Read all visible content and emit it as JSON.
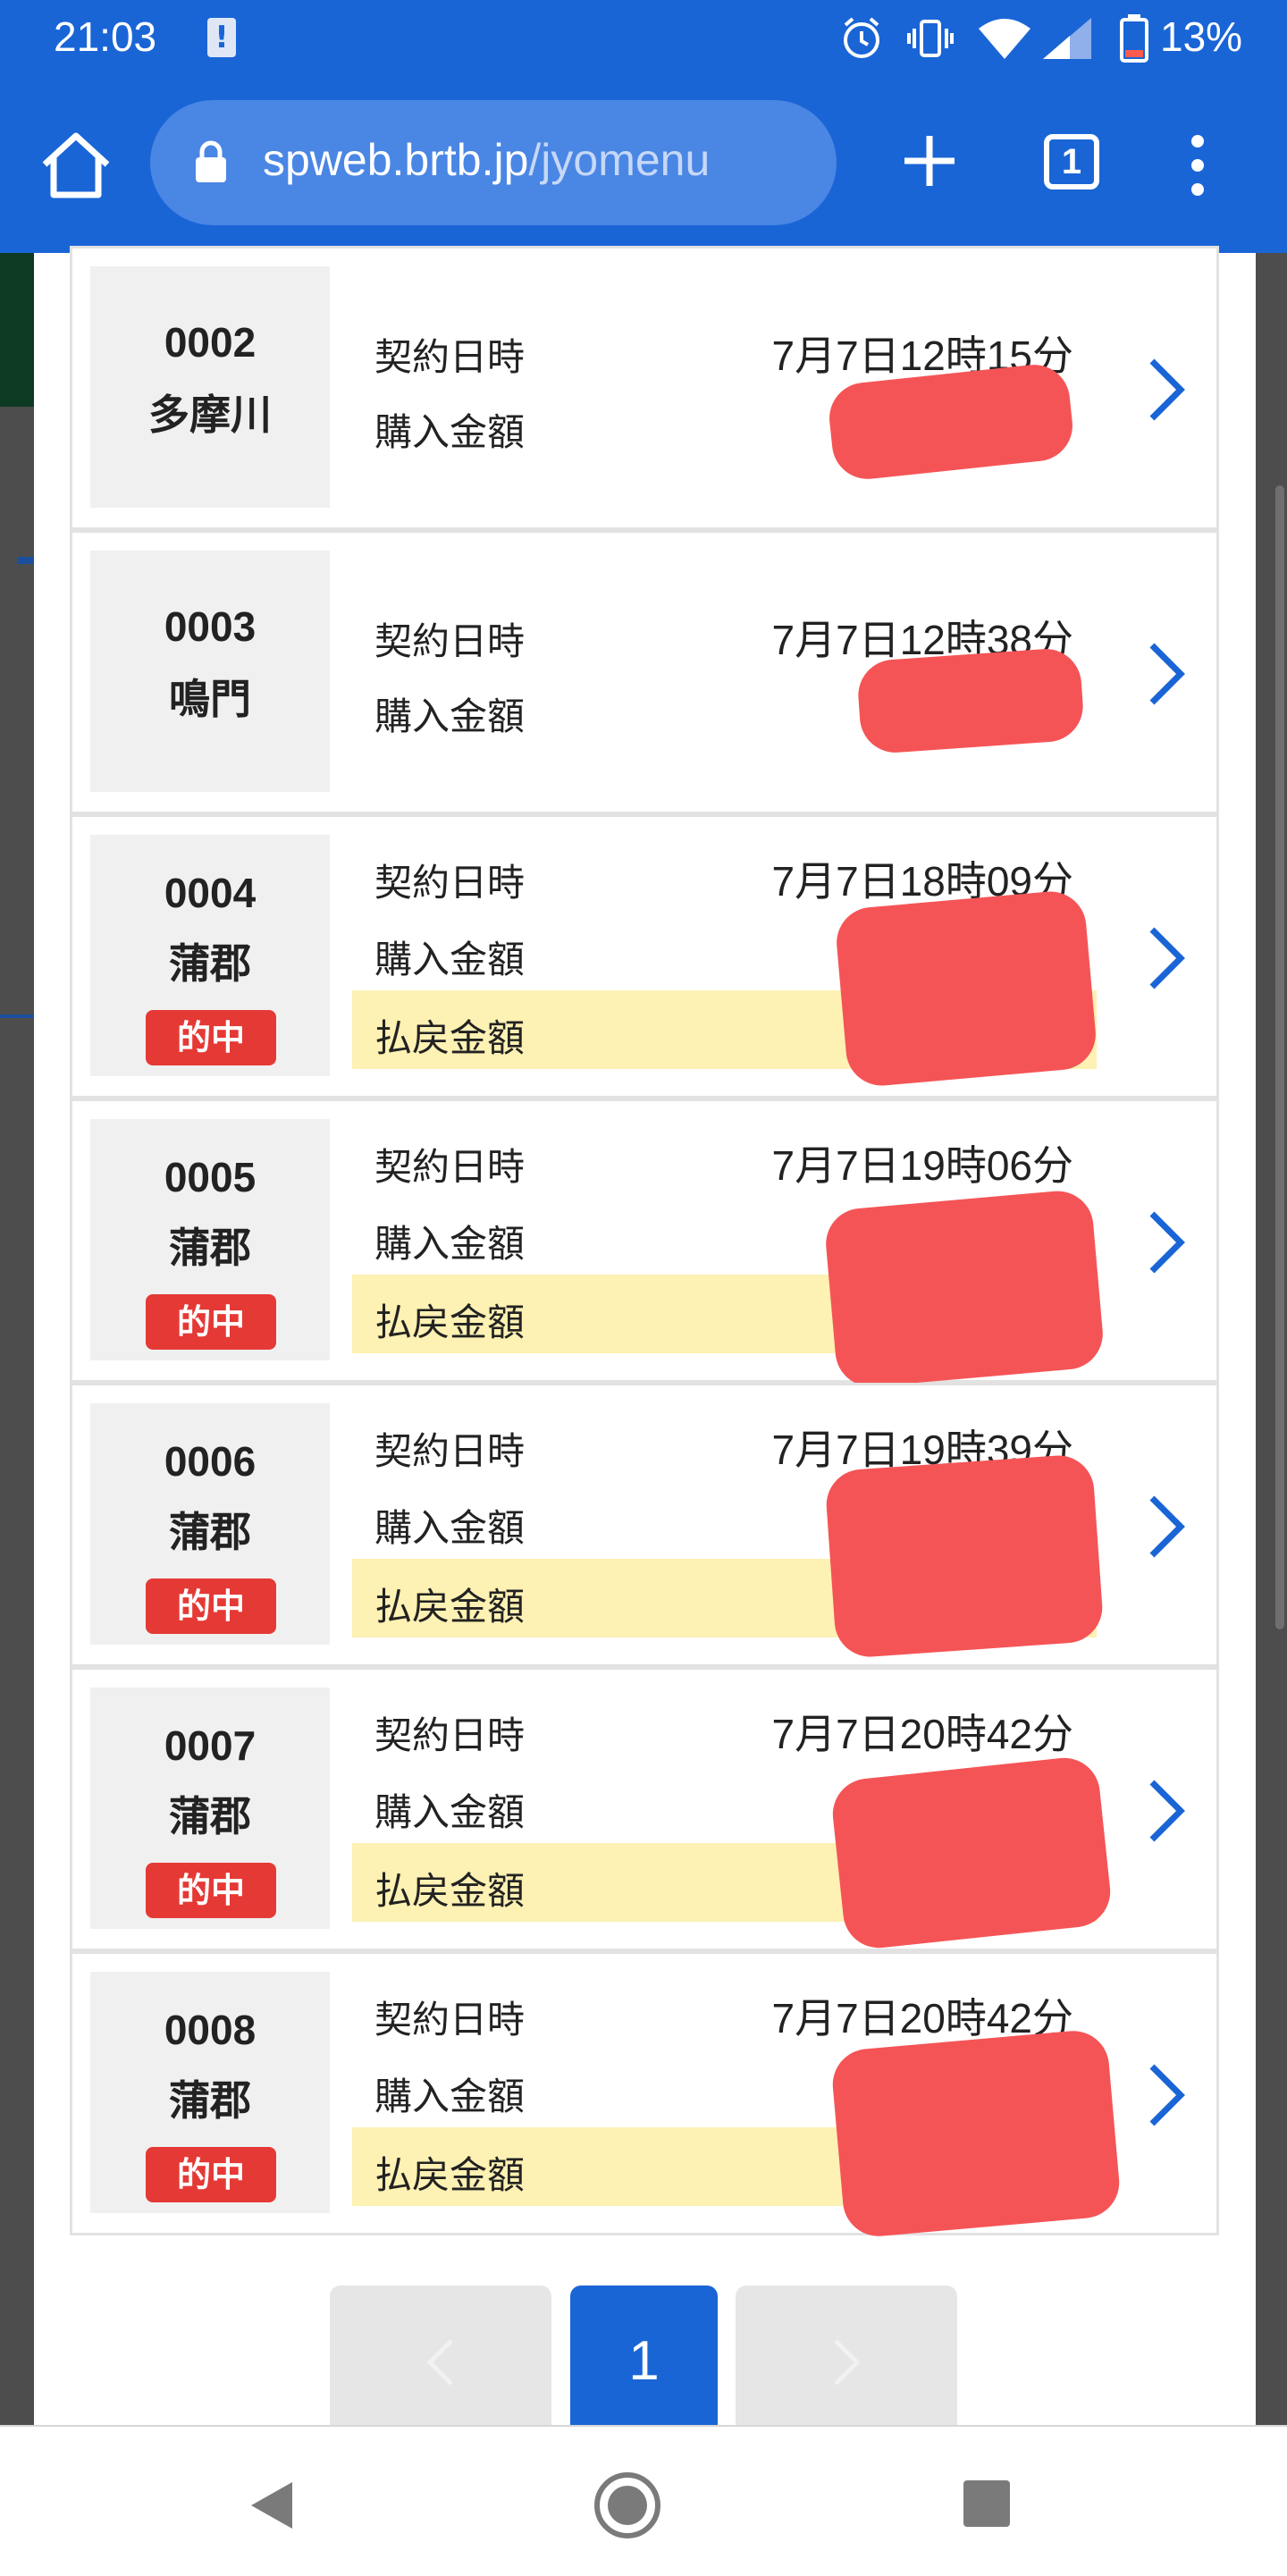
{
  "status_bar": {
    "time": "21:03",
    "battery": "13%"
  },
  "browser": {
    "url_domain": "spweb.brtb.jp",
    "url_path": "/jyomenu",
    "tab_count": "1"
  },
  "labels": {
    "contract": "契約日時",
    "purchase": "購入金額",
    "payout": "払戻金額",
    "hit": "的中"
  },
  "rows": [
    {
      "num": "0002",
      "venue": "多摩川",
      "datetime": "7月7日12時15分",
      "hit": false
    },
    {
      "num": "0003",
      "venue": "鳴門",
      "datetime": "7月7日12時38分",
      "hit": false
    },
    {
      "num": "0004",
      "venue": "蒲郡",
      "datetime": "7月7日18時09分",
      "hit": true
    },
    {
      "num": "0005",
      "venue": "蒲郡",
      "datetime": "7月7日19時06分",
      "hit": true
    },
    {
      "num": "0006",
      "venue": "蒲郡",
      "datetime": "7月7日19時39分",
      "hit": true
    },
    {
      "num": "0007",
      "venue": "蒲郡",
      "datetime": "7月7日20時42分",
      "hit": true
    },
    {
      "num": "0008",
      "venue": "蒲郡",
      "datetime": "7月7日20時42分",
      "hit": true
    }
  ],
  "pagination": {
    "current": "1"
  },
  "colors": {
    "brand": "#1a65d6",
    "hit_badge": "#e53935",
    "payout_band": "#fdf1b3",
    "redaction": "#f55456"
  }
}
